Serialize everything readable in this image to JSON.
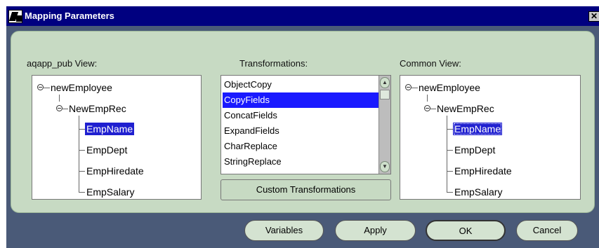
{
  "window": {
    "title": "Mapping Parameters",
    "close_glyph": "✕"
  },
  "source_view": {
    "label": "aqapp_pub View:",
    "root": "newEmployee",
    "record": "NewEmpRec",
    "fields": [
      "EmpName",
      "EmpDept",
      "EmpHiredate",
      "EmpSalary"
    ],
    "selected": "EmpName"
  },
  "transformations": {
    "label": "Transformations:",
    "items": [
      "ObjectCopy",
      "CopyFields",
      "ConcatFields",
      "ExpandFields",
      "CharReplace",
      "StringReplace"
    ],
    "selected": "CopyFields",
    "custom_button": "Custom Transformations",
    "scroll_up_glyph": "▲",
    "scroll_down_glyph": "▼"
  },
  "common_view": {
    "label": "Common View:",
    "root": "newEmployee",
    "record": "NewEmpRec",
    "fields": [
      "EmpName",
      "EmpDept",
      "EmpHiredate",
      "EmpSalary"
    ],
    "selected": "EmpName"
  },
  "buttons": {
    "variables": "Variables",
    "apply": "Apply",
    "ok": "OK",
    "cancel": "Cancel"
  },
  "colors": {
    "title_bar": "#000080",
    "panel": "#c7dac3",
    "selection": "#2020d0",
    "window_bg": "#4a5a78"
  }
}
